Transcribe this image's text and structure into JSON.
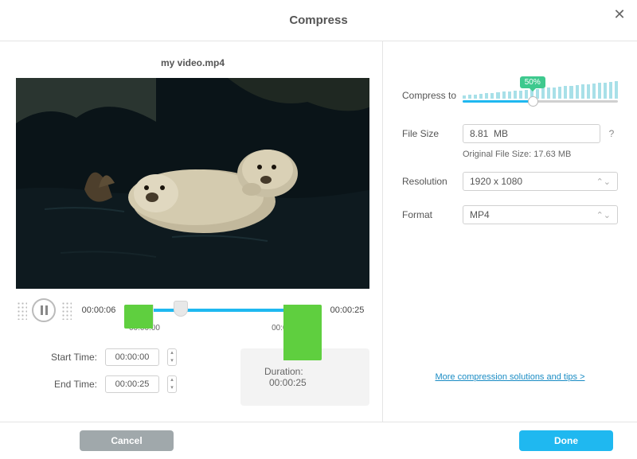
{
  "header": {
    "title": "Compress"
  },
  "left": {
    "filename": "my video.mp4",
    "currentTime": "00:00:06",
    "totalTime": "00:00:25",
    "rangeStart": "00:00:00",
    "rangeEnd": "00:00:25",
    "startLabel": "Start Time:",
    "endLabel": "End Time:",
    "startVal": "00:00:00",
    "endVal": "00:00:25",
    "durationLabel": "Duration:",
    "durationVal": "00:00:25"
  },
  "right": {
    "compressLabel": "Compress to",
    "compressPct": "50%",
    "compressPos": 45,
    "fileSizeLabel": "File Size",
    "fileSizeVal": "8.81  MB",
    "origSizeText": "Original File Size: 17.63 MB",
    "resolutionLabel": "Resolution",
    "resolutionVal": "1920 x 1080",
    "formatLabel": "Format",
    "formatVal": "MP4",
    "tipsLink": "More compression solutions and tips >"
  },
  "footer": {
    "cancel": "Cancel",
    "done": "Done"
  }
}
